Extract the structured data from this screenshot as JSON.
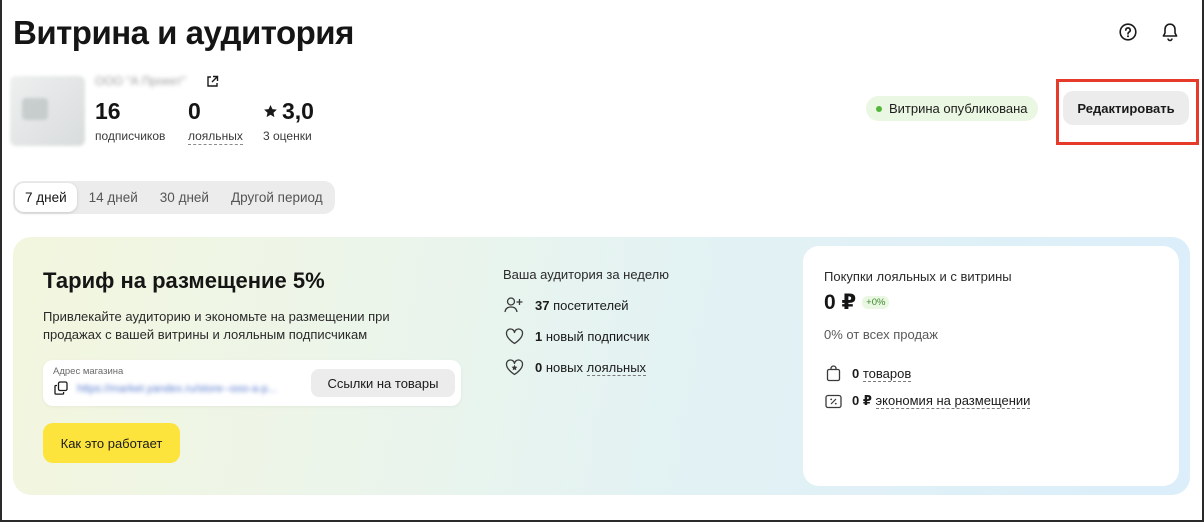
{
  "header": {
    "title": "Витрина и аудитория"
  },
  "profile": {
    "org_name": "ООО \"А Проект\"",
    "subscribers": {
      "value": "16",
      "label": "подписчиков"
    },
    "loyal": {
      "value": "0",
      "label": "лояльных"
    },
    "rating": {
      "value": "3,0",
      "label": "3 оценки"
    }
  },
  "status": {
    "label": "Витрина опубликована",
    "color": "#53b83a"
  },
  "actions": {
    "edit_label": "Редактировать"
  },
  "period_tabs": [
    {
      "label": "7 дней",
      "active": true
    },
    {
      "label": "14 дней",
      "active": false
    },
    {
      "label": "30 дней",
      "active": false
    },
    {
      "label": "Другой период",
      "active": false
    }
  ],
  "promo": {
    "title": "Тариф на размещение 5%",
    "description": "Привлекайте аудиторию и экономьте на размещении при продажах с вашей витрины и лояльным подписчикам",
    "address_label": "Адрес магазина",
    "address_url": "https://market.yandex.ru/store--ooo-a-p...",
    "links_button": "Ссылки на товары",
    "how_button": "Как это работает"
  },
  "audience": {
    "title": "Ваша аудитория за неделю",
    "visitors": {
      "value": "37",
      "label": "посетителей"
    },
    "new_subscribers": {
      "value": "1",
      "label": "новый подписчик"
    },
    "new_loyal": {
      "value": "0",
      "label_prefix": "новых",
      "label_link": "лояльных"
    }
  },
  "sales": {
    "title": "Покупки лояльных и с витрины",
    "amount": "0 ₽",
    "delta": "+0%",
    "share": "0% от всех продаж",
    "goods": {
      "value": "0",
      "label": "товаров"
    },
    "savings": {
      "value": "0 ₽",
      "label": "экономия на размещении"
    }
  },
  "colors": {
    "highlight": "#e63a2a",
    "primary_button": "#fde43c"
  }
}
